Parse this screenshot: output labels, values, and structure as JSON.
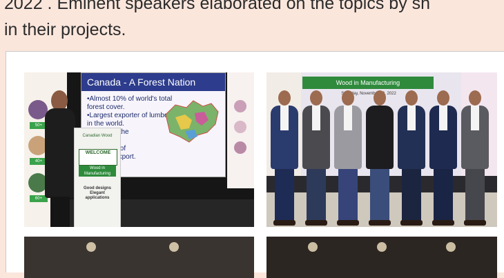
{
  "article": {
    "lines": [
      "2022 . Eminent speakers elaborated on the topics by sh",
      "in their projects."
    ]
  },
  "photo1": {
    "slide_title": "Canada - A Forest Nation",
    "bullets": [
      "•Almost 10% of world's total",
      "  forest cover.",
      "•Largest exporter of lumber",
      "  in the world.",
      "  ation over the",
      "  es.",
      "  ts for 50% of",
      "  tal wood export."
    ],
    "podium_logo": "Canadian Wood",
    "podium_welcome": "WELCOME",
    "podium_band": "Wood in Manufacturing",
    "podium_slogan": "Good designs Elegant applications",
    "banner_tags": [
      "50+",
      "40+",
      "60+"
    ]
  },
  "photo2": {
    "banner": "Wood in Manufacturing",
    "sub": "Saturday, November 19, 2022",
    "people": [
      {
        "suit": "#2a3b6e",
        "legs": "#1e2b55",
        "shirt": true
      },
      {
        "suit": "#4a4a4f",
        "legs": "#2e3a5a",
        "shirt": true
      },
      {
        "suit": "#9a9aa0",
        "legs": "#36447a",
        "shirt": true
      },
      {
        "suit": "#1d1d1f",
        "legs": "#3b4d7a",
        "shirt": false
      },
      {
        "suit": "#233055",
        "legs": "#1b2540",
        "shirt": true
      },
      {
        "suit": "#1e2a50",
        "legs": "#1a2444",
        "shirt": true
      },
      {
        "suit": "#5a5b60",
        "legs": "#46474c",
        "shirt": true
      }
    ]
  }
}
